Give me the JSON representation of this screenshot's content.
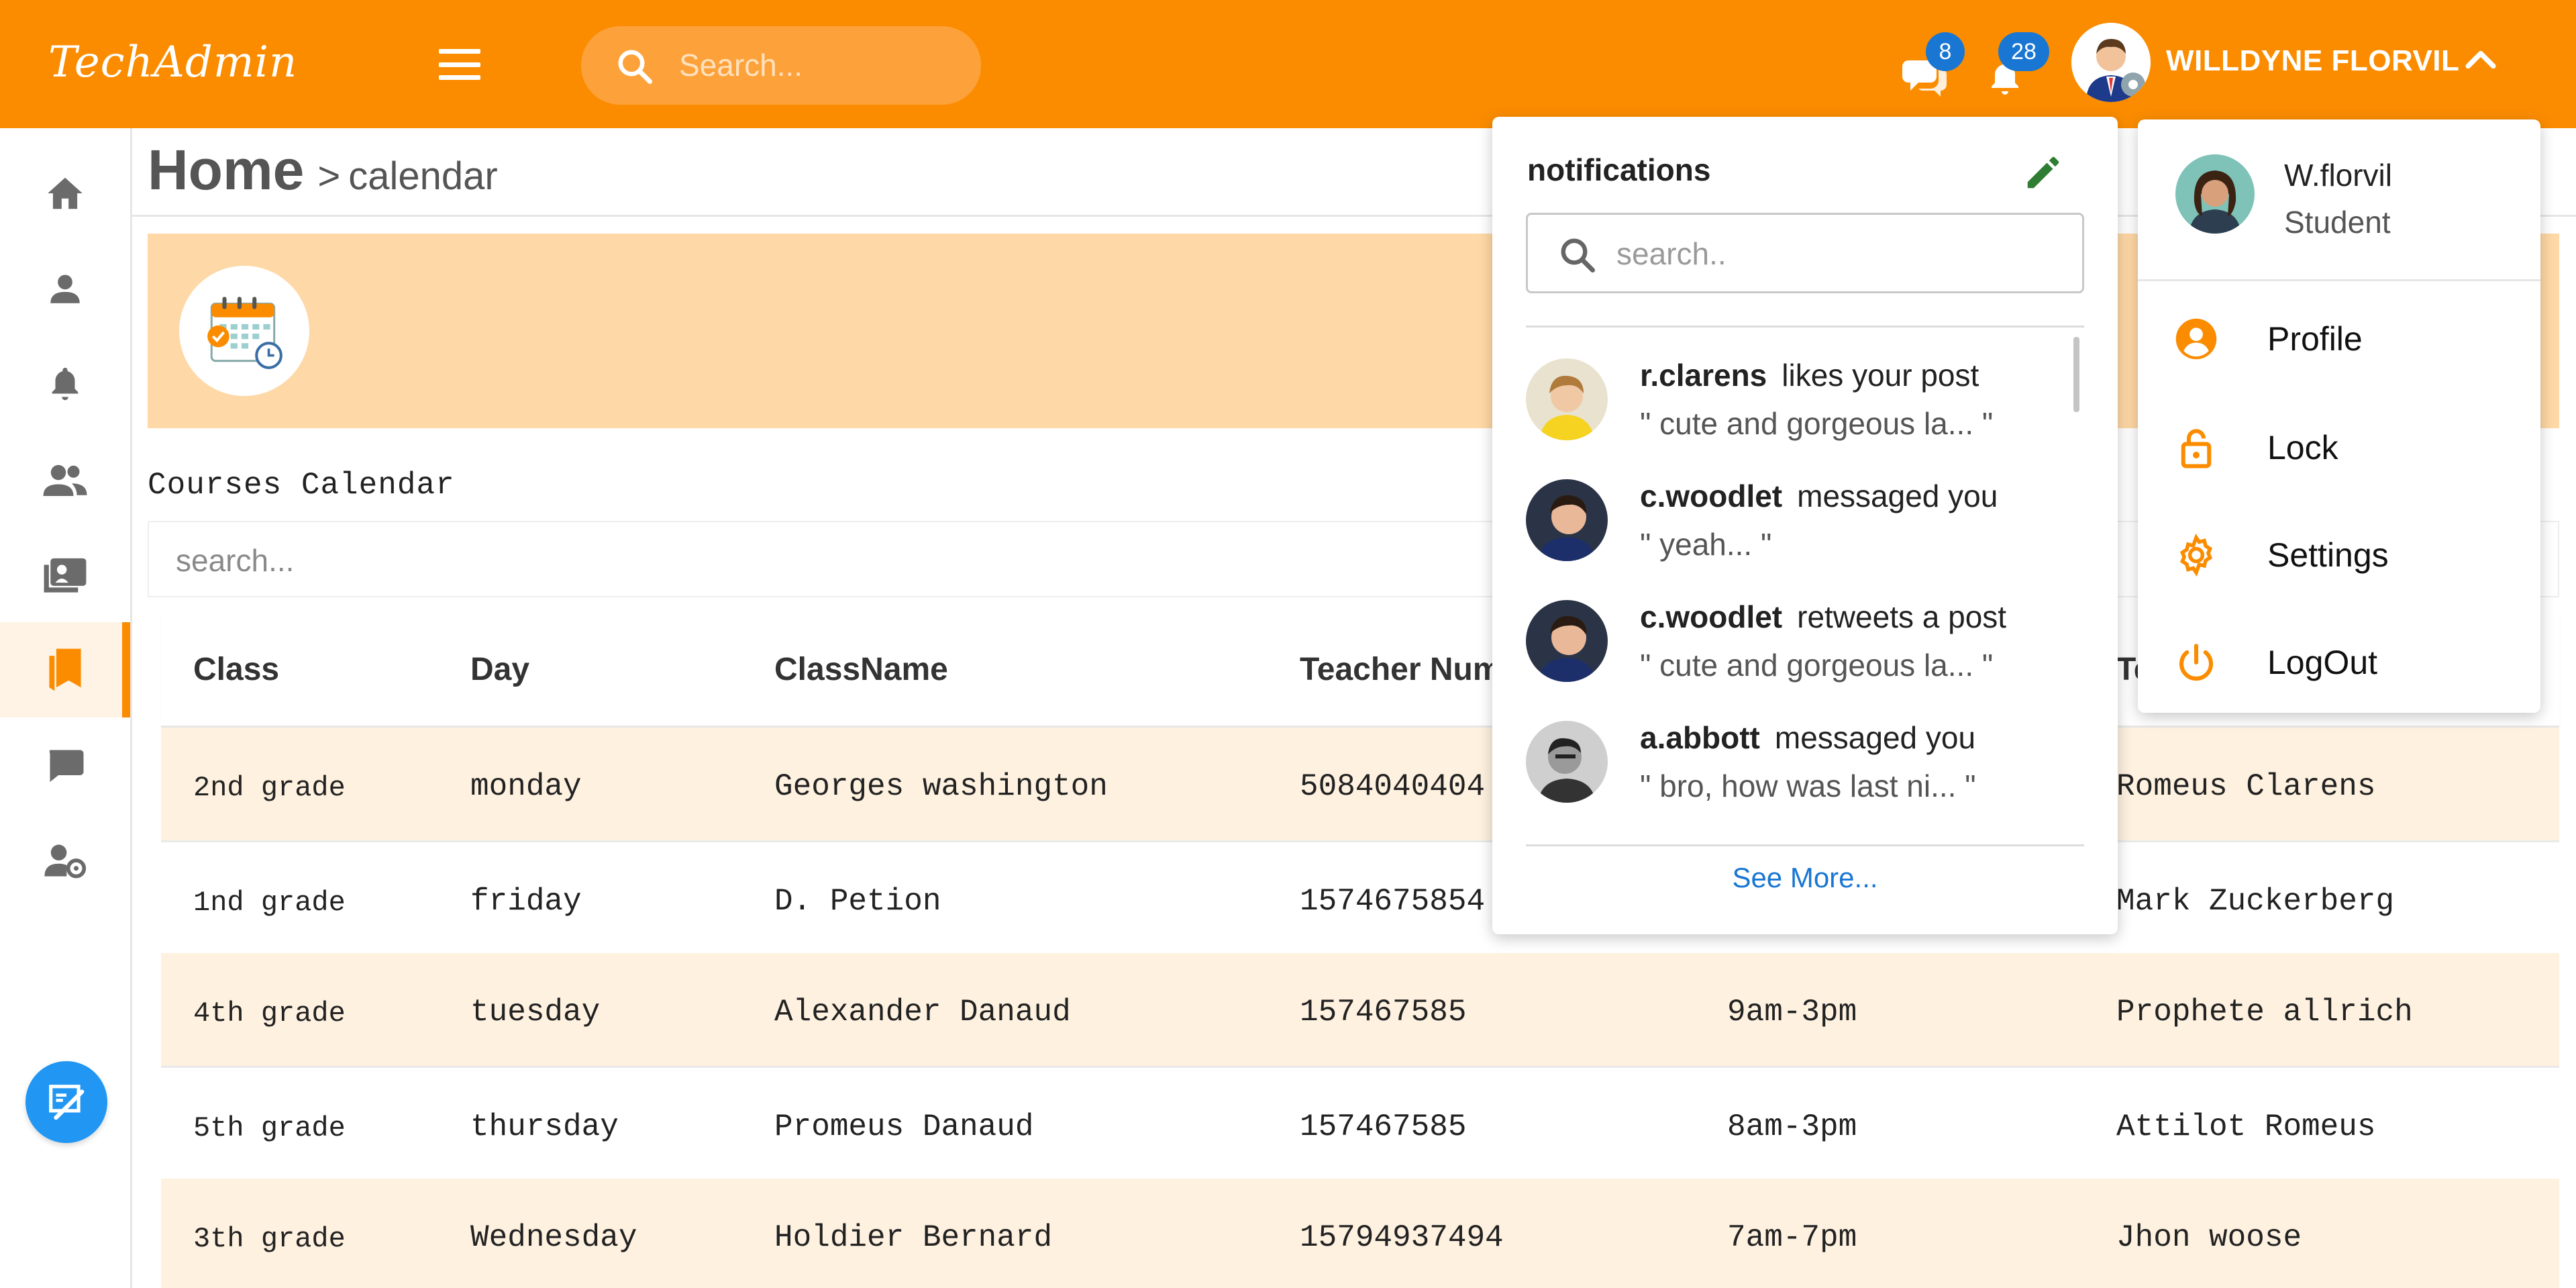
{
  "app": {
    "brand": "TechAdmin"
  },
  "header": {
    "search_placeholder": "Search...",
    "messages_count": "8",
    "notifications_count": "28",
    "user_name": "WILLDYNE FLORVIL"
  },
  "breadcrumb": {
    "home": "Home",
    "separator": ">",
    "page": "calendar"
  },
  "page": {
    "section_title": "Courses Calendar",
    "table_search_placeholder": "search..."
  },
  "table": {
    "headers": [
      "Class",
      "Day",
      "ClassName",
      "Teacher Num",
      "",
      "Te"
    ],
    "rows": [
      [
        "2nd grade",
        "monday",
        "Georges washington",
        "5084040404",
        "",
        "Romeus Clarens"
      ],
      [
        "1nd grade",
        "friday",
        "D. Petion",
        "1574675854",
        "",
        "Mark Zuckerberg"
      ],
      [
        "4th grade",
        "tuesday",
        "Alexander Danaud",
        "157467585",
        "9am-3pm",
        "Prophete allrich"
      ],
      [
        "5th grade",
        "thursday",
        "Promeus Danaud",
        "157467585",
        "8am-3pm",
        "Attilot Romeus"
      ],
      [
        "3th grade",
        "Wednesday",
        "Holdier Bernard",
        "15794937494",
        "7am-7pm",
        "Jhon woose"
      ]
    ]
  },
  "notifications": {
    "title": "notifications",
    "search_placeholder": "search..",
    "items": [
      {
        "user": "r.clarens",
        "action": "likes your post",
        "preview": "\" cute and gorgeous la... \""
      },
      {
        "user": "c.woodlet",
        "action": "messaged you",
        "preview": "\" yeah... \""
      },
      {
        "user": "c.woodlet",
        "action": "retweets a post",
        "preview": "\" cute and gorgeous la... \""
      },
      {
        "user": "a.abbott",
        "action": "messaged you",
        "preview": "\" bro, how was last ni... \""
      }
    ],
    "see_more": "See More..."
  },
  "profile_menu": {
    "name": "W.florvil",
    "role": "Student",
    "items": [
      "Profile",
      "Lock",
      "Settings",
      "LogOut"
    ]
  },
  "colors": {
    "primary": "#fb8c00",
    "banner": "#fed8a6",
    "row_tint": "#fef1e0",
    "accent_blue": "#1976d2",
    "fab": "#2196f3"
  }
}
